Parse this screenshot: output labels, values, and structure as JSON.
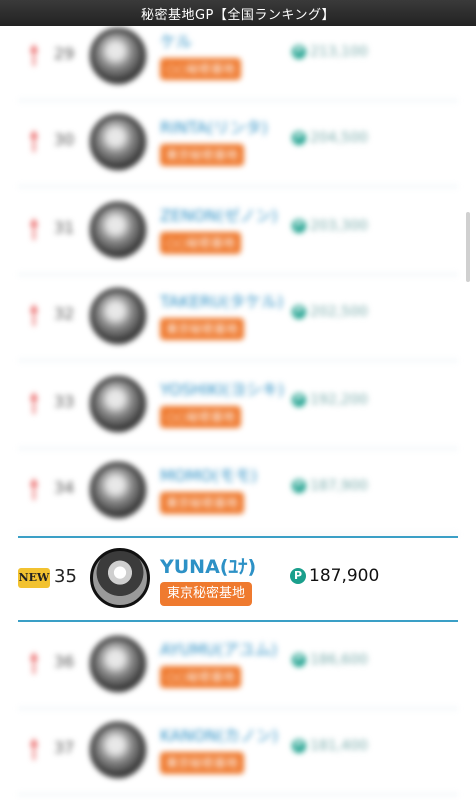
{
  "window": {
    "title": "秘密基地GP【全国ランキング】"
  },
  "rows_above": [
    {
      "rank": "29",
      "name": "ケル",
      "store": "○○秘密基地",
      "points": "213,100"
    },
    {
      "rank": "30",
      "name": "RINTA(リンタ)",
      "store": "東京秘密基地",
      "points": "204,500"
    },
    {
      "rank": "31",
      "name": "ZENON(ゼノン)",
      "store": "○○秘密基地",
      "points": "203,300"
    },
    {
      "rank": "32",
      "name": "TAKERU(タケル)",
      "store": "東京秘密基地",
      "points": "202,500"
    },
    {
      "rank": "33",
      "name": "YOSHIKI(ヨシキ)",
      "store": "○○秘密基地",
      "points": "192,200"
    },
    {
      "rank": "34",
      "name": "MOMO(モモ)",
      "store": "東京秘密基地",
      "points": "187,900"
    }
  ],
  "focused": {
    "badge": "NEW",
    "rank": "35",
    "name": "YUNA(ﾕﾅ)",
    "store": "東京秘密基地",
    "points_icon": "P",
    "points": "187,900"
  },
  "rows_below": [
    {
      "rank": "36",
      "name": "AYUMU(アユム)",
      "store": "○○秘密基地",
      "points": "186,600"
    },
    {
      "rank": "37",
      "name": "KANON(カノン)",
      "store": "東京秘密基地",
      "points": "181,400"
    }
  ],
  "colors": {
    "accent_blue": "#2d91c6",
    "tag_orange": "#ef7a2f",
    "points_teal": "#1a9f8c",
    "new_badge": "#f2c230"
  }
}
